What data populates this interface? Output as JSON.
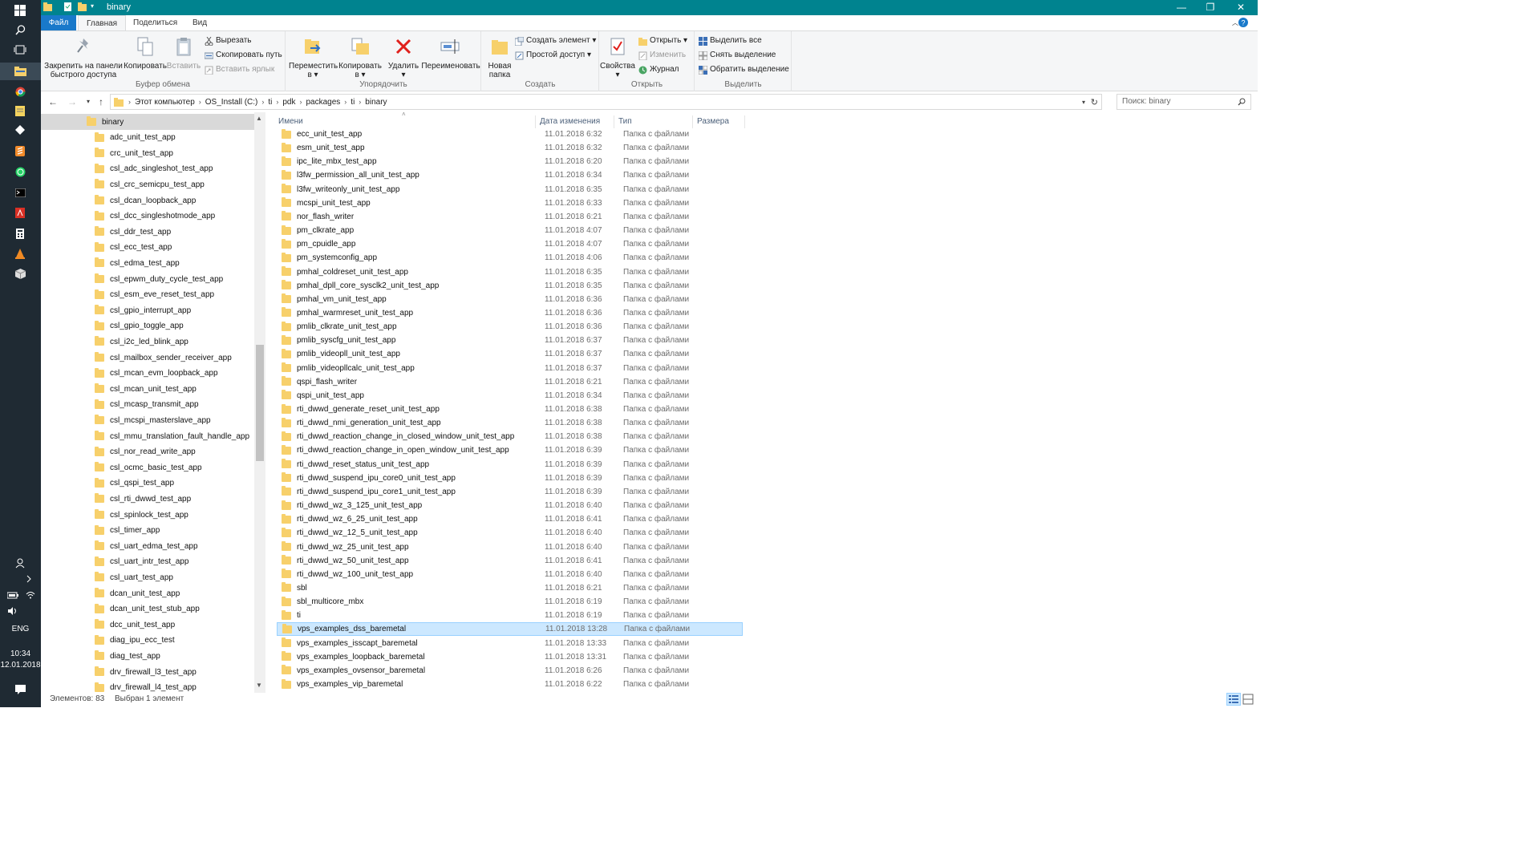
{
  "window": {
    "title": "binary",
    "minimize": "—",
    "maximize": "❐",
    "close": "✕"
  },
  "ribbon_tabs": [
    "Файл",
    "Главная",
    "Поделиться",
    "Вид"
  ],
  "ribbon": {
    "clipboard": {
      "label": "Буфер обмена",
      "pin": "Закрепить на панели\nбыстрого доступа",
      "copy": "Копировать",
      "paste": "Вставить",
      "cut": "Вырезать",
      "copy_path": "Скопировать путь",
      "paste_shortcut": "Вставить ярлык"
    },
    "organize": {
      "label": "Упорядочить",
      "move_to": "Переместить\nв ▾",
      "copy_to": "Копировать\nв ▾",
      "delete": "Удалить\n▾",
      "rename": "Переименовать"
    },
    "create": {
      "label": "Создать",
      "new_folder": "Новая\nпапка",
      "new_item": "Создать элемент ▾",
      "easy_access": "Простой доступ ▾"
    },
    "open": {
      "label": "Открыть",
      "properties": "Свойства\n▾",
      "open": "Открыть ▾",
      "edit": "Изменить",
      "history": "Журнал"
    },
    "select": {
      "label": "Выделить",
      "select_all": "Выделить все",
      "select_none": "Снять выделение",
      "invert": "Обратить выделение"
    }
  },
  "address": {
    "crumbs": [
      "Этот компьютер",
      "OS_Install (C:)",
      "ti",
      "pdk",
      "packages",
      "ti",
      "binary"
    ],
    "search_placeholder": "Поиск: binary"
  },
  "nav_tree": [
    "binary",
    "adc_unit_test_app",
    "crc_unit_test_app",
    "csl_adc_singleshot_test_app",
    "csl_crc_semicpu_test_app",
    "csl_dcan_loopback_app",
    "csl_dcc_singleshotmode_app",
    "csl_ddr_test_app",
    "csl_ecc_test_app",
    "csl_edma_test_app",
    "csl_epwm_duty_cycle_test_app",
    "csl_esm_eve_reset_test_app",
    "csl_gpio_interrupt_app",
    "csl_gpio_toggle_app",
    "csl_i2c_led_blink_app",
    "csl_mailbox_sender_receiver_app",
    "csl_mcan_evm_loopback_app",
    "csl_mcan_unit_test_app",
    "csl_mcasp_transmit_app",
    "csl_mcspi_masterslave_app",
    "csl_mmu_translation_fault_handle_app",
    "csl_nor_read_write_app",
    "csl_ocmc_basic_test_app",
    "csl_qspi_test_app",
    "csl_rti_dwwd_test_app",
    "csl_spinlock_test_app",
    "csl_timer_app",
    "csl_uart_edma_test_app",
    "csl_uart_intr_test_app",
    "csl_uart_test_app",
    "dcan_unit_test_app",
    "dcan_unit_test_stub_app",
    "dcc_unit_test_app",
    "diag_ipu_ecc_test",
    "diag_test_app",
    "drv_firewall_l3_test_app",
    "drv_firewall_l4_test_app"
  ],
  "columns": {
    "name": "Имени",
    "date": "Дата изменения",
    "type": "Тип",
    "size": "Размера"
  },
  "folder_type": "Папка с файлами",
  "files": [
    {
      "name": "ecc_unit_test_app",
      "date": "11.01.2018 6:32"
    },
    {
      "name": "esm_unit_test_app",
      "date": "11.01.2018 6:32"
    },
    {
      "name": "ipc_lite_mbx_test_app",
      "date": "11.01.2018 6:20"
    },
    {
      "name": "l3fw_permission_all_unit_test_app",
      "date": "11.01.2018 6:34"
    },
    {
      "name": "l3fw_writeonly_unit_test_app",
      "date": "11.01.2018 6:35"
    },
    {
      "name": "mcspi_unit_test_app",
      "date": "11.01.2018 6:33"
    },
    {
      "name": "nor_flash_writer",
      "date": "11.01.2018 6:21"
    },
    {
      "name": "pm_clkrate_app",
      "date": "11.01.2018 4:07"
    },
    {
      "name": "pm_cpuidle_app",
      "date": "11.01.2018 4:07"
    },
    {
      "name": "pm_systemconfig_app",
      "date": "11.01.2018 4:06"
    },
    {
      "name": "pmhal_coldreset_unit_test_app",
      "date": "11.01.2018 6:35"
    },
    {
      "name": "pmhal_dpll_core_sysclk2_unit_test_app",
      "date": "11.01.2018 6:35"
    },
    {
      "name": "pmhal_vm_unit_test_app",
      "date": "11.01.2018 6:36"
    },
    {
      "name": "pmhal_warmreset_unit_test_app",
      "date": "11.01.2018 6:36"
    },
    {
      "name": "pmlib_clkrate_unit_test_app",
      "date": "11.01.2018 6:36"
    },
    {
      "name": "pmlib_syscfg_unit_test_app",
      "date": "11.01.2018 6:37"
    },
    {
      "name": "pmlib_videopll_unit_test_app",
      "date": "11.01.2018 6:37"
    },
    {
      "name": "pmlib_videopllcalc_unit_test_app",
      "date": "11.01.2018 6:37"
    },
    {
      "name": "qspi_flash_writer",
      "date": "11.01.2018 6:21"
    },
    {
      "name": "qspi_unit_test_app",
      "date": "11.01.2018 6:34"
    },
    {
      "name": "rti_dwwd_generate_reset_unit_test_app",
      "date": "11.01.2018 6:38"
    },
    {
      "name": "rti_dwwd_nmi_generation_unit_test_app",
      "date": "11.01.2018 6:38"
    },
    {
      "name": "rti_dwwd_reaction_change_in_closed_window_unit_test_app",
      "date": "11.01.2018 6:38"
    },
    {
      "name": "rti_dwwd_reaction_change_in_open_window_unit_test_app",
      "date": "11.01.2018 6:39"
    },
    {
      "name": "rti_dwwd_reset_status_unit_test_app",
      "date": "11.01.2018 6:39"
    },
    {
      "name": "rti_dwwd_suspend_ipu_core0_unit_test_app",
      "date": "11.01.2018 6:39"
    },
    {
      "name": "rti_dwwd_suspend_ipu_core1_unit_test_app",
      "date": "11.01.2018 6:39"
    },
    {
      "name": "rti_dwwd_wz_3_125_unit_test_app",
      "date": "11.01.2018 6:40"
    },
    {
      "name": "rti_dwwd_wz_6_25_unit_test_app",
      "date": "11.01.2018 6:41"
    },
    {
      "name": "rti_dwwd_wz_12_5_unit_test_app",
      "date": "11.01.2018 6:40"
    },
    {
      "name": "rti_dwwd_wz_25_unit_test_app",
      "date": "11.01.2018 6:40"
    },
    {
      "name": "rti_dwwd_wz_50_unit_test_app",
      "date": "11.01.2018 6:41"
    },
    {
      "name": "rti_dwwd_wz_100_unit_test_app",
      "date": "11.01.2018 6:40"
    },
    {
      "name": "sbl",
      "date": "11.01.2018 6:21"
    },
    {
      "name": "sbl_multicore_mbx",
      "date": "11.01.2018 6:19"
    },
    {
      "name": "ti",
      "date": "11.01.2018 6:19"
    },
    {
      "name": "vps_examples_dss_baremetal",
      "date": "11.01.2018 13:28",
      "selected": true
    },
    {
      "name": "vps_examples_isscapt_baremetal",
      "date": "11.01.2018 13:33"
    },
    {
      "name": "vps_examples_loopback_baremetal",
      "date": "11.01.2018 13:31"
    },
    {
      "name": "vps_examples_ovsensor_baremetal",
      "date": "11.01.2018 6:26"
    },
    {
      "name": "vps_examples_vip_baremetal",
      "date": "11.01.2018 6:22"
    }
  ],
  "status": {
    "count": "Элементов: 83",
    "selection": "Выбран 1 элемент"
  },
  "tray": {
    "lang": "ENG",
    "time": "10:34",
    "date": "12.01.2018"
  },
  "colors": {
    "accent": "#00838f",
    "file_tab": "#1979ca",
    "selection": "#cce8ff",
    "folder": "#f7d06b"
  }
}
